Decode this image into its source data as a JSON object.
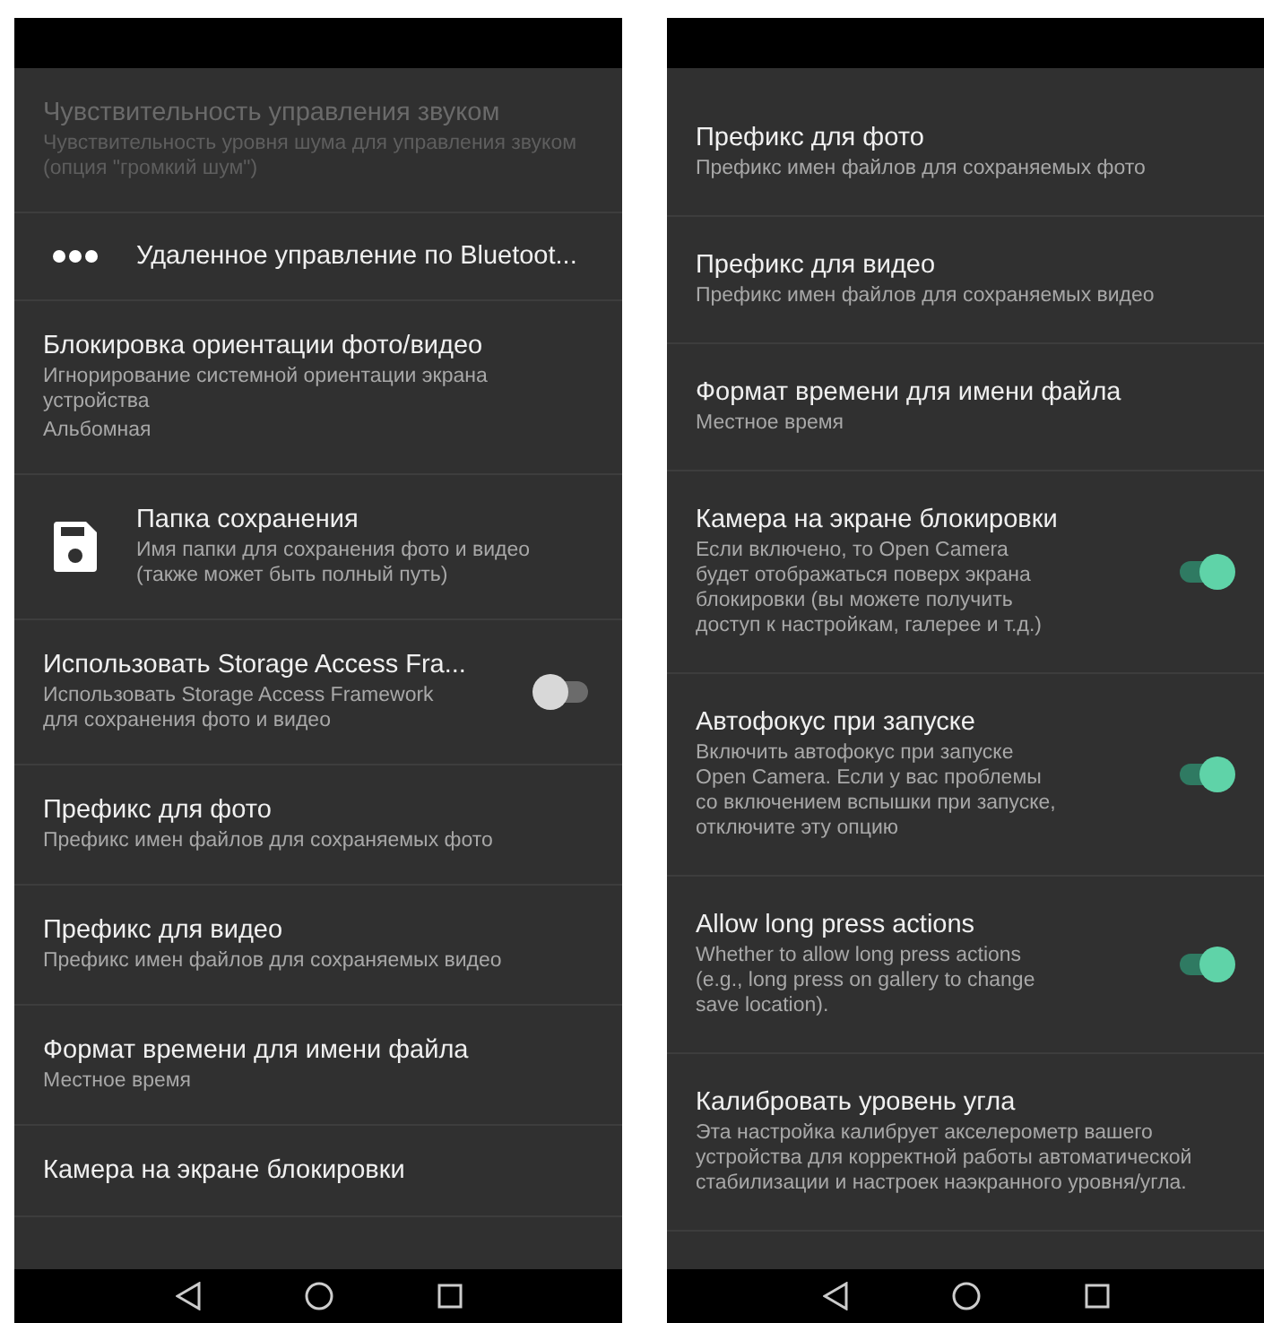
{
  "screens": [
    {
      "items": [
        {
          "kind": "text",
          "title": "Чувствительность управления звуком",
          "summary": "Чувствительность уровня шума для управления звуком (опция \"громкий шум\")",
          "disabled": true
        },
        {
          "kind": "menu",
          "title": "Удаленное управление по Bluetoot...",
          "disabled": false
        },
        {
          "kind": "text",
          "title": "Блокировка ориентации фото/видео",
          "summary": "Игнорирование системной ориентации экрана устройства",
          "value": "Альбомная",
          "disabled": false
        },
        {
          "kind": "folder",
          "title": "Папка сохранения",
          "summary": "Имя папки для сохранения фото и видео (также может быть полный путь)",
          "disabled": false
        },
        {
          "kind": "switch",
          "title": "Использовать Storage Access Fra...",
          "summary": "Использовать Storage Access Framework для сохранения фото и видео",
          "checked": false,
          "disabled": false
        },
        {
          "kind": "text",
          "title": "Префикс для фото",
          "summary": "Префикс имен файлов для сохраняемых фото",
          "disabled": false
        },
        {
          "kind": "text",
          "title": "Префикс для видео",
          "summary": "Префикс имен файлов для сохраняемых видео",
          "disabled": false
        },
        {
          "kind": "text",
          "title": "Формат времени для имени файла",
          "summary": "Местное время",
          "disabled": false
        },
        {
          "kind": "text",
          "title": "Камера на экране блокировки",
          "disabled": false
        }
      ]
    },
    {
      "items": [
        {
          "kind": "text",
          "title": "Префикс для фото",
          "summary": "Префикс имен файлов для сохраняемых фото",
          "disabled": false
        },
        {
          "kind": "text",
          "title": "Префикс для видео",
          "summary": "Префикс имен файлов для сохраняемых видео",
          "disabled": false
        },
        {
          "kind": "text",
          "title": "Формат времени для имени файла",
          "summary": "Местное время",
          "disabled": false
        },
        {
          "kind": "switch",
          "title": "Камера на экране блокировки",
          "summary": "Если включено, то Open Camera будет отображаться поверх экрана блокировки (вы можете получить доступ к настройкам, галерее и т.д.)",
          "checked": true,
          "disabled": false
        },
        {
          "kind": "switch",
          "title": "Автофокус при запуске",
          "summary": "Включить автофокус при запуске Open Camera. Если у вас проблемы со включением вспышки при запуске, отключите эту опцию",
          "checked": true,
          "disabled": false
        },
        {
          "kind": "switch",
          "title": "Allow long press actions",
          "summary": "Whether to allow long press actions (e.g., long press on gallery to change save location).",
          "checked": true,
          "disabled": false
        },
        {
          "kind": "text",
          "title": "Калибровать уровень угла",
          "summary": "Эта настройка калибрует акселерометр вашего устройства для корректной работы автоматической стабилизации и настроек наэкранного уровня/угла.",
          "disabled": false
        }
      ]
    }
  ]
}
